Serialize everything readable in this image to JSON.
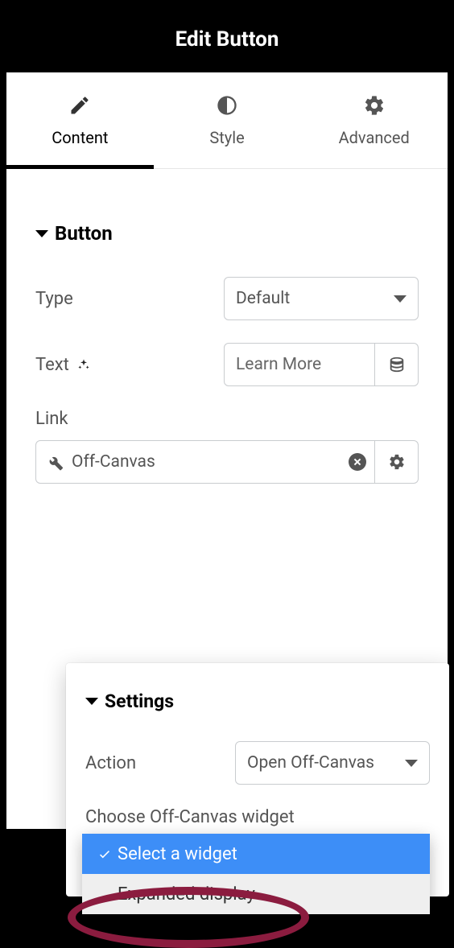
{
  "header": {
    "title": "Edit Button"
  },
  "tabs": {
    "content_label": "Content",
    "style_label": "Style",
    "advanced_label": "Advanced"
  },
  "button_section": {
    "title": "Button",
    "type_label": "Type",
    "type_value": "Default",
    "text_label": "Text",
    "text_value": "Learn More",
    "link_label": "Link",
    "link_value": "Off-Canvas"
  },
  "settings_popover": {
    "title": "Settings",
    "action_label": "Action",
    "action_value": "Open Off-Canvas",
    "choose_label": "Choose Off-Canvas widget",
    "options": {
      "select_widget": "Select a widget",
      "expanded_display": "Expanded display"
    }
  }
}
